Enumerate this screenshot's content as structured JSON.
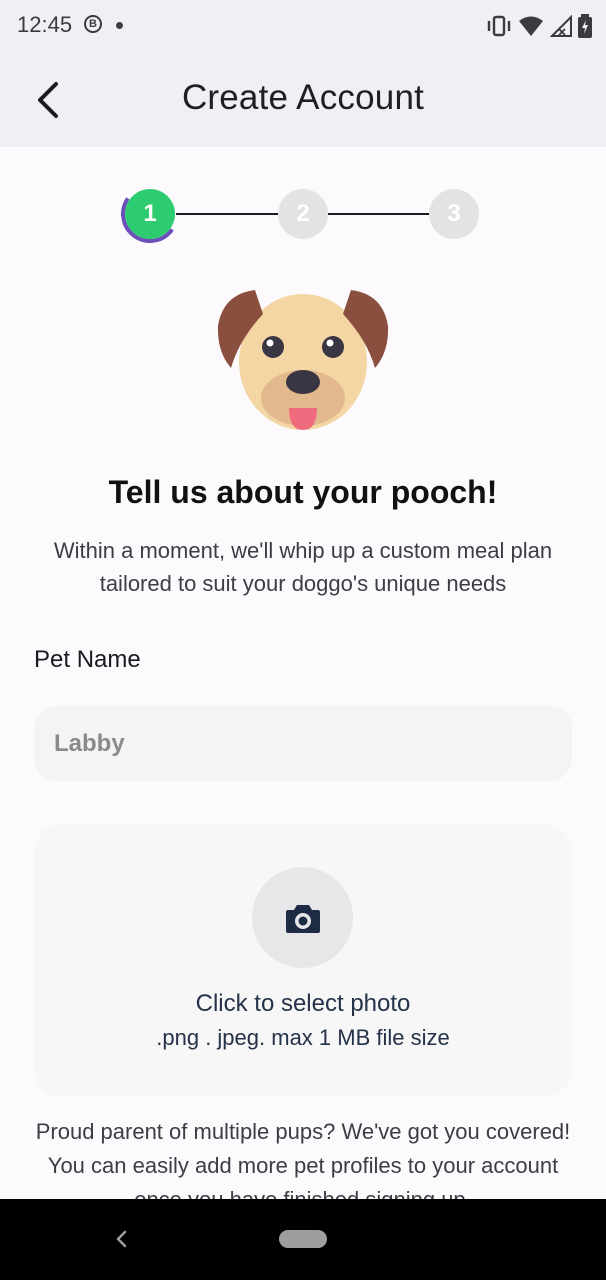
{
  "status": {
    "time": "12:45",
    "badge": "B",
    "icons": [
      "vibrate-icon",
      "wifi-icon",
      "signal-icon",
      "battery-charging-icon"
    ]
  },
  "app_bar": {
    "title": "Create Account",
    "back_icon": "arrow-back-icon"
  },
  "stepper": {
    "steps": [
      "1",
      "2",
      "3"
    ],
    "active_step": 1,
    "colors": {
      "active": "#2ecc71",
      "inactive": "#e3e3e6",
      "ring": "#6a4fb8"
    }
  },
  "intro": {
    "heading": "Tell us about your pooch!",
    "subtitle": "Within a moment, we'll whip up a custom meal plan tailored to suit your doggo's unique needs"
  },
  "form": {
    "pet_name_label": "Pet Name",
    "pet_name_placeholder": "Labby",
    "photo": {
      "icon": "camera-icon",
      "title": "Click to select photo",
      "hint": ".png . jpeg. max 1 MB file size"
    }
  },
  "footer_note": "Proud parent of multiple pups? We've got you covered! You can easily add more pet profiles to your account once you have finished signing up.",
  "nav": {
    "back_icon": "nav-back-icon",
    "home_icon": "nav-home-pill"
  }
}
